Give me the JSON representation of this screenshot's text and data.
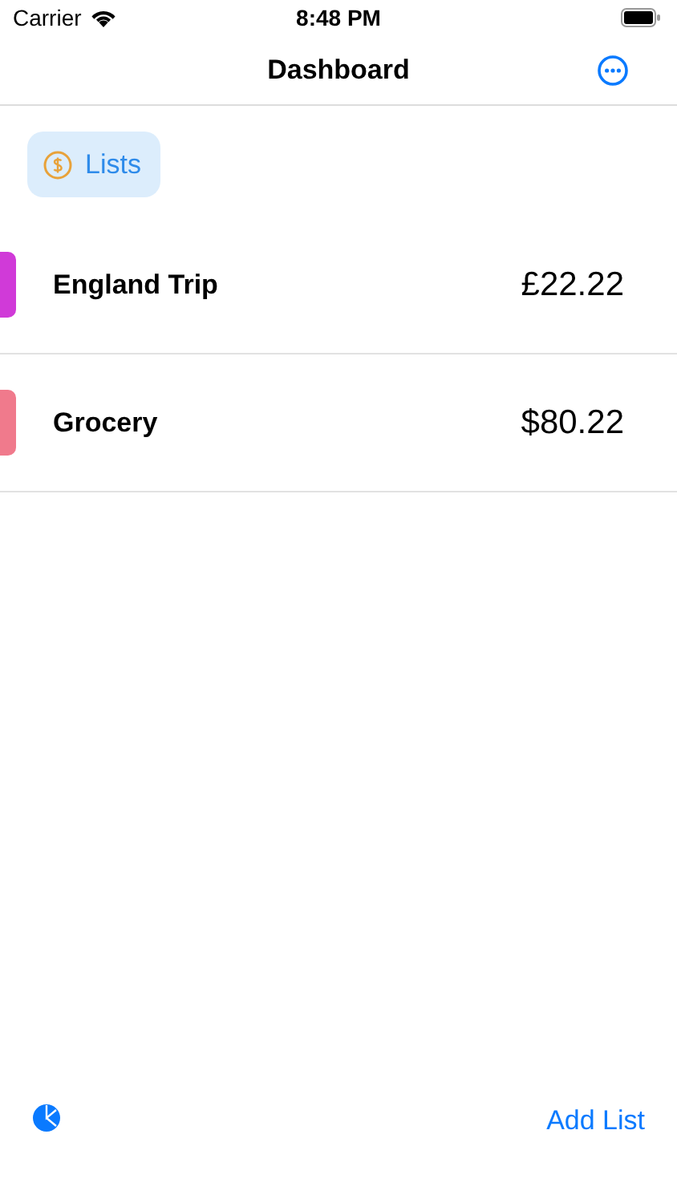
{
  "status_bar": {
    "carrier": "Carrier",
    "time": "8:48 PM"
  },
  "nav": {
    "title": "Dashboard"
  },
  "filter_chip": {
    "label": "Lists"
  },
  "lists": [
    {
      "name": "England Trip",
      "amount": "£22.22",
      "color": "#d03ad8"
    },
    {
      "name": "Grocery",
      "amount": "$80.22",
      "color": "#f07a8c"
    }
  ],
  "toolbar": {
    "add_button": "Add List"
  }
}
